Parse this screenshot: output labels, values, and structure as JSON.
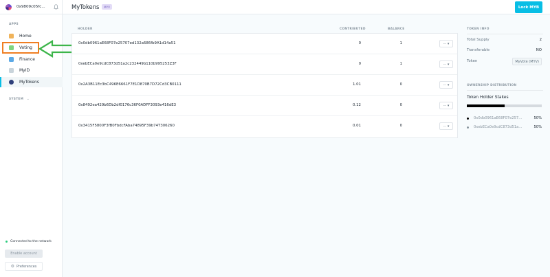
{
  "account": {
    "address": "0x9809c05fc..."
  },
  "sidebar": {
    "apps_label": "APPS",
    "items": [
      {
        "label": "Home",
        "color": "#f0b35a"
      },
      {
        "label": "Voting",
        "color": "#7fd47f"
      },
      {
        "label": "Finance",
        "color": "#5ca9e6"
      },
      {
        "label": "MyID",
        "color": "#c9d4db"
      },
      {
        "label": "MyTokens",
        "color": "#2f3f7a"
      }
    ],
    "active_index": 4,
    "system_label": "SYSTEM"
  },
  "status": {
    "connected": "Connected to the network",
    "connected_color": "#2ccc7f"
  },
  "footer": {
    "enable_account": "Enable account",
    "preferences": "Preferences"
  },
  "header": {
    "title": "MyTokens",
    "tag": "MYV",
    "lock_button": "Lock MYB"
  },
  "table": {
    "columns": {
      "holder": "HOLDER",
      "contributed": "CONTRIBUTED",
      "balance": "BALANCE"
    },
    "rows": [
      {
        "holder": "0x0db0961aE68F07e25707ed132a686fb9A1d14a51",
        "contributed": "0",
        "balance": "1"
      },
      {
        "holder": "0xebECa0e9cdC873d51a2c232449b110b995253Z3F",
        "contributed": "0",
        "balance": "1"
      },
      {
        "holder": "0x2A3B11Ec3bC496E6661F7E1D870B7D72Cd3CB0111",
        "contributed": "1.01",
        "balance": "0"
      },
      {
        "holder": "0x8492ea429b6Db2df0176c36F0ADFF3093e416dE3",
        "contributed": "0.12",
        "balance": "0"
      },
      {
        "holder": "0x3415F5800F3fB0FbdcFAba74895F39b74T306260",
        "contributed": "0.01",
        "balance": "0"
      }
    ],
    "more_label": "··· ▾"
  },
  "token_info": {
    "label": "TOKEN INFO",
    "total_supply_label": "Total Supply",
    "total_supply": "2",
    "transferable_label": "Transferable",
    "transferable": "NO",
    "token_label": "Token",
    "token": "MyVote (MYV)"
  },
  "ownership": {
    "label": "OWNERSHIP DISTRIBUTION",
    "title": "Token Holder Stakes",
    "holders": [
      {
        "address": "0x0db0961aE68F07e257...",
        "percent": "50%",
        "share": 0.5,
        "color": "#000000"
      },
      {
        "address": "0xebECa0e9cdC873d51a...",
        "percent": "50%",
        "share": 0.5,
        "color": "#8a96a0"
      }
    ]
  },
  "annotation": {
    "box_color": "#ef7e22",
    "arrow_color": "#3cb54a"
  }
}
